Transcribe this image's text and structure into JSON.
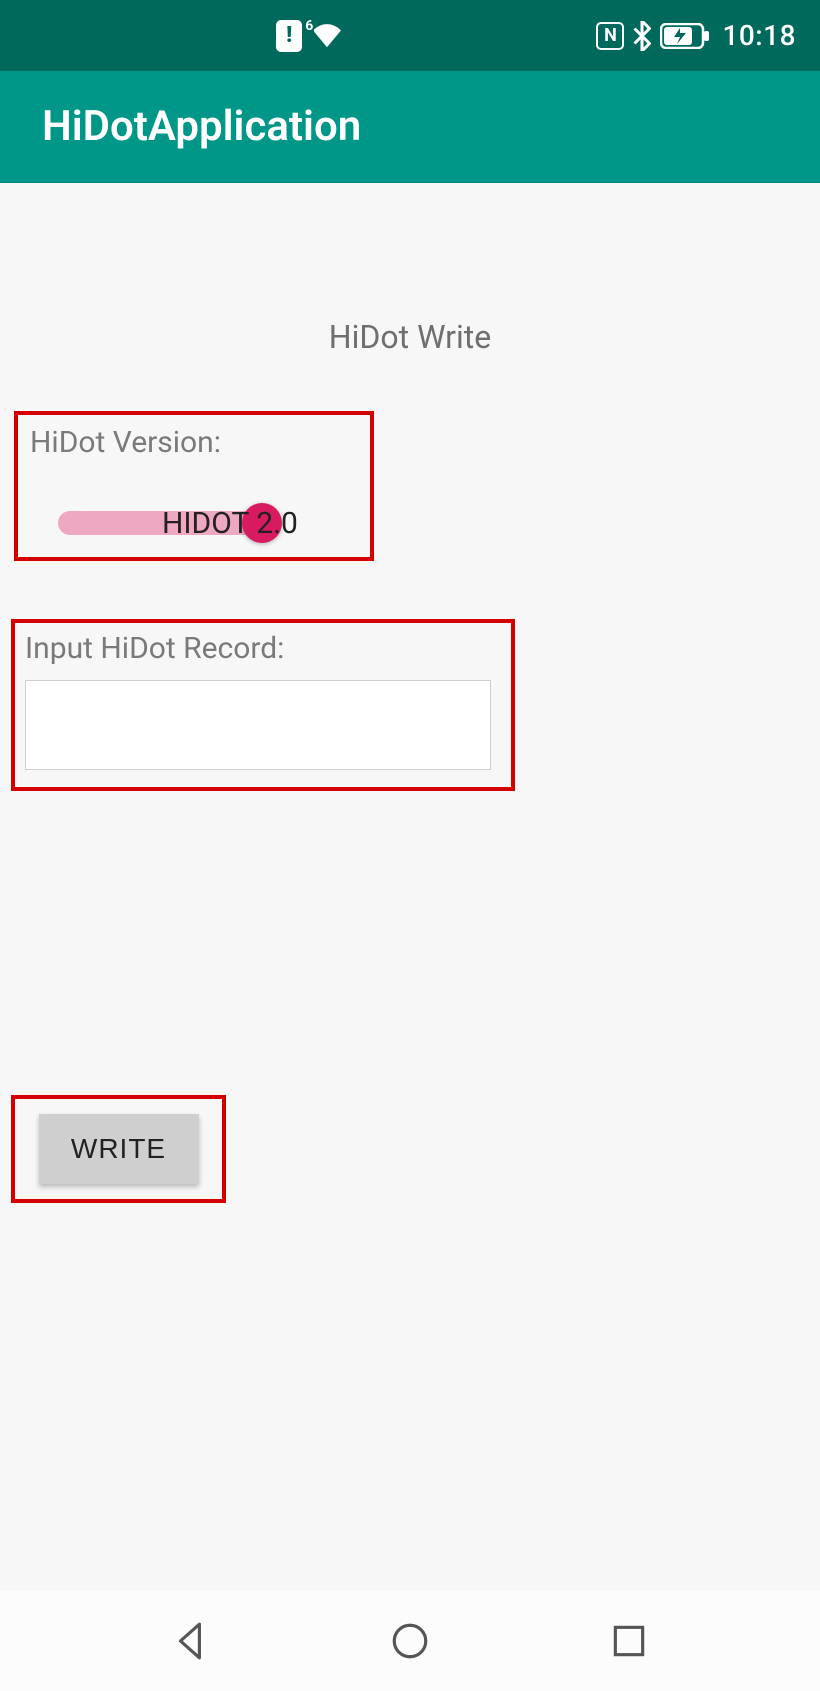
{
  "status": {
    "wifi_badge": "6",
    "clock": "10:18"
  },
  "appbar": {
    "title": "HiDotApplication"
  },
  "page": {
    "heading": "HiDot Write"
  },
  "version": {
    "label": "HiDot Version:",
    "switch_label": "HIDOT 2.0",
    "switch_on": true
  },
  "record": {
    "label": "Input HiDot Record:",
    "value": ""
  },
  "actions": {
    "write_label": "WRITE"
  }
}
